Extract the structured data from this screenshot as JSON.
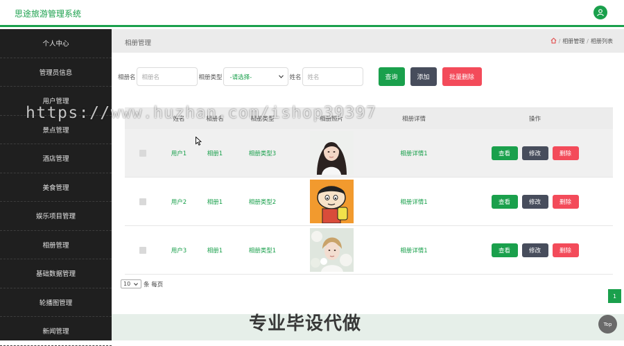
{
  "app": {
    "title": "思途旅游管理系统"
  },
  "sidebar": {
    "items": [
      {
        "label": "个人中心"
      },
      {
        "label": "管理员信息"
      },
      {
        "label": "用户管理"
      },
      {
        "label": "景点管理"
      },
      {
        "label": "酒店管理"
      },
      {
        "label": "美食管理"
      },
      {
        "label": "娱乐项目管理"
      },
      {
        "label": "相册管理"
      },
      {
        "label": "基础数据管理"
      },
      {
        "label": "轮播图管理"
      },
      {
        "label": "新闻管理"
      }
    ]
  },
  "page": {
    "title": "相册管理",
    "breadcrumb": [
      "相册管理",
      "相册列表"
    ]
  },
  "search": {
    "album_label": "相册名",
    "album_placeholder": "相册名",
    "type_label": "相册类型",
    "type_selected": "-请选择-",
    "name_label": "姓名",
    "name_placeholder": "姓名",
    "query_button": "查询",
    "add_button": "添加",
    "batch_delete_button": "批量删除"
  },
  "table": {
    "headers": [
      "姓名",
      "相册名",
      "相册类型",
      "相册照片",
      "相册详情",
      "操作"
    ],
    "rows": [
      {
        "user": "用户1",
        "album": "相册1",
        "type": "相册类型3",
        "detail": "相册详情1"
      },
      {
        "user": "用户2",
        "album": "相册1",
        "type": "相册类型2",
        "detail": "相册详情1"
      },
      {
        "user": "用户3",
        "album": "相册1",
        "type": "相册类型1",
        "detail": "相册详情1"
      }
    ],
    "actions": {
      "view": "查看",
      "edit": "修改",
      "delete": "删除"
    }
  },
  "pager": {
    "page_size": "10",
    "per_page_label": "条 每页",
    "current_page": "1"
  },
  "overlay": {
    "watermark": "https://www.huzhan.com/ishop39397",
    "caption": "专业毕设代做",
    "top_button": "Top"
  },
  "colors": {
    "accent": "#1aa04c",
    "sidebar": "#1f1f1f",
    "edit": "#474d5c",
    "danger": "#f34b5a"
  },
  "icons": [
    "user-icon",
    "home-icon",
    "chevron-down-icon",
    "cursor-icon"
  ]
}
